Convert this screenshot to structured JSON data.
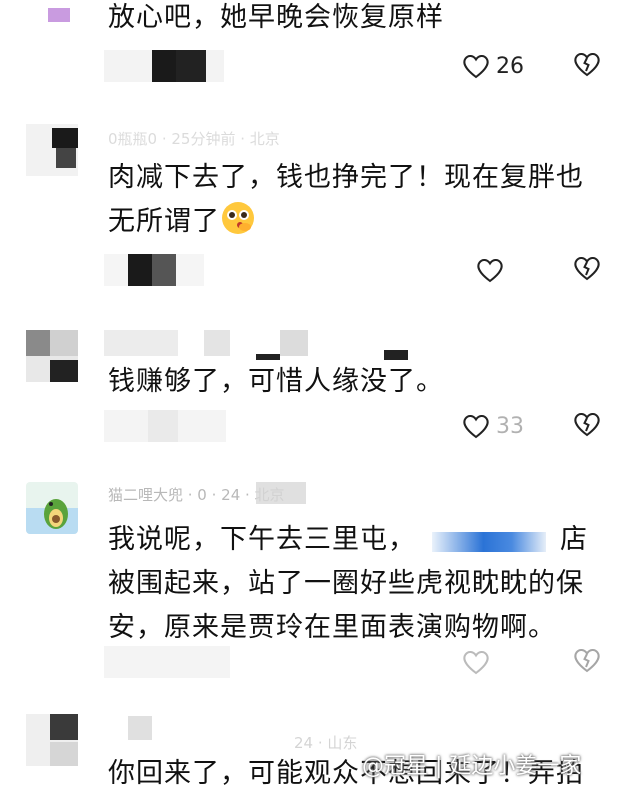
{
  "comments": [
    {
      "text": "放心吧，她早晚会恢复原样",
      "likes": "26"
    },
    {
      "meta": "0瓶瓶0 · 25分钟前 · 北京",
      "text_line1": "肉减下去了，钱也挣完了！现在复胖也",
      "text_line2": "无所谓了",
      "emoji": "pleading-face-emoji",
      "likes": ""
    },
    {
      "meta": "",
      "text": "钱赚够了，可惜人缘没了。",
      "likes": "33"
    },
    {
      "meta": "猫二哩大兜 · 0 · 24 · 北京",
      "text_line1": "我说呢，下午去三里屯，",
      "text_line1_end": "店",
      "text_line2": "被围起来，站了一圈好些虎视眈眈的保",
      "text_line3": "安，原来是贾玲在里面表演购物啊。",
      "likes": ""
    },
    {
      "meta": "24 · 山东",
      "text": "你回来了，可能观众不想回来了！弄拍"
    }
  ],
  "watermark": "@冠星 | 延边小姜一家",
  "colors": {
    "text": "#111111",
    "meta": "#b8b8b8",
    "icon": "#222222"
  }
}
